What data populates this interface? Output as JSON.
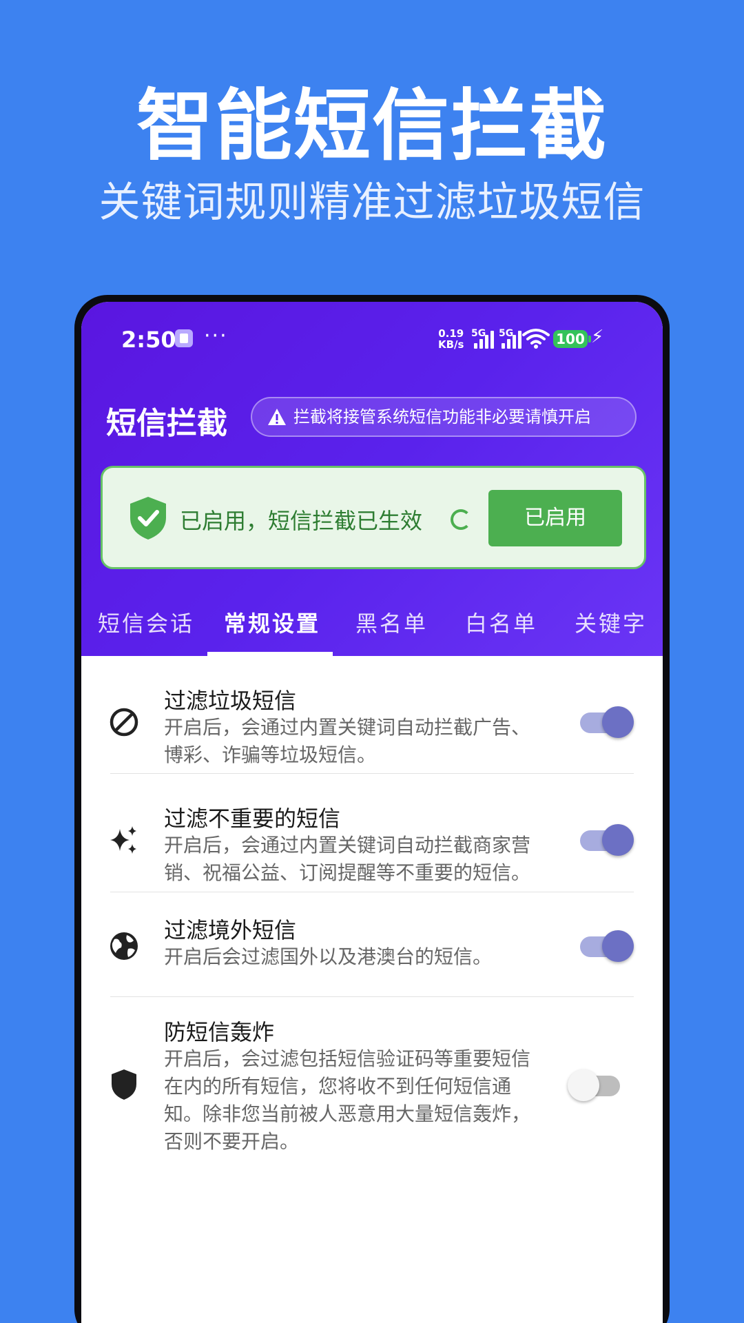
{
  "promo": {
    "title": "智能短信拦截",
    "subtitle": "关键词规则精准过滤垃圾短信"
  },
  "statusbar": {
    "time": "2:50",
    "dots": "···",
    "net_speed_value": "0.19",
    "net_speed_unit": "KB/s",
    "signal1_label": "5G",
    "signal2_label": "5G",
    "battery": "100",
    "bolt": "⚡"
  },
  "header": {
    "app_title": "短信拦截",
    "warning": "拦截将接管系统短信功能非必要请慎开启"
  },
  "status_card": {
    "text": "已启用，短信拦截已生效",
    "button_label": "已启用",
    "accent_color": "#4caf50"
  },
  "tabs": [
    {
      "label": "短信会话",
      "active": false
    },
    {
      "label": "常规设置",
      "active": true
    },
    {
      "label": "黑名单",
      "active": false
    },
    {
      "label": "白名单",
      "active": false
    },
    {
      "label": "关键字",
      "active": false
    }
  ],
  "settings": [
    {
      "icon": "block-icon",
      "title": "过滤垃圾短信",
      "desc_lines": [
        "开启后，会通过内置关键词自动拦截广告、",
        "博彩、诈骗等垃圾短信。"
      ],
      "enabled": true
    },
    {
      "icon": "sparkle-icon",
      "title": "过滤不重要的短信",
      "desc_lines": [
        "开启后，会通过内置关键词自动拦截商家营",
        "销、祝福公益、订阅提醒等不重要的短信。"
      ],
      "enabled": true
    },
    {
      "icon": "globe-icon",
      "title": "过滤境外短信",
      "desc_lines": [
        "开启后会过滤国外以及港澳台的短信。"
      ],
      "enabled": true
    },
    {
      "icon": "shield-icon",
      "title": "防短信轰炸",
      "desc_lines": [
        "开启后，会过滤包括短信验证码等重要短信",
        "在内的所有短信，您将收不到任何短信通",
        "知。除非您当前被人恶意用大量短信轰炸，",
        "否则不要开启。"
      ],
      "enabled": false
    }
  ]
}
